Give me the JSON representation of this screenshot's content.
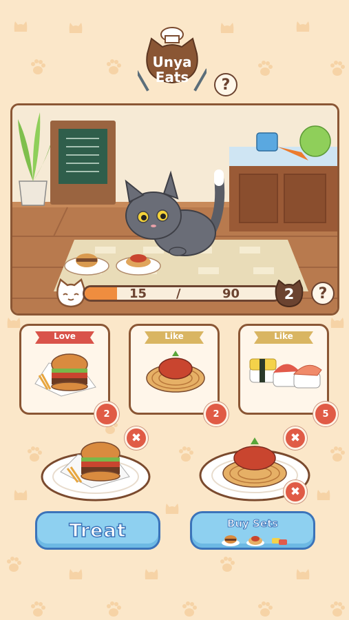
{
  "logo": {
    "line1": "Unya",
    "line2": "Eats"
  },
  "help_glyph": "?",
  "progress": {
    "current": "15",
    "separator": "/",
    "goal": "90",
    "fraction": 0.167
  },
  "level": "2",
  "cards": [
    {
      "ribbon": "Love",
      "food": "burger",
      "count": "2",
      "ribbon_color": "#d9534a"
    },
    {
      "ribbon": "Like",
      "food": "spaghetti",
      "count": "2",
      "ribbon_color": "#d9b562"
    },
    {
      "ribbon": "Like",
      "food": "sushi",
      "count": "5",
      "ribbon_color": "#d9b562"
    }
  ],
  "tray": [
    {
      "food": "burger",
      "remove_glyph": "✖"
    },
    {
      "food": "spaghetti",
      "remove_glyph": "✖"
    }
  ],
  "remove_glyph": "✖",
  "buttons": {
    "treat": "Treat",
    "buy_sets": "Buy Sets"
  },
  "colors": {
    "background": "#fbe7c9",
    "accent_orange": "#ef8d3f",
    "button_blue": "#8ed0f0",
    "badge_red": "#e05b46",
    "frame_brown": "#8a5634"
  }
}
